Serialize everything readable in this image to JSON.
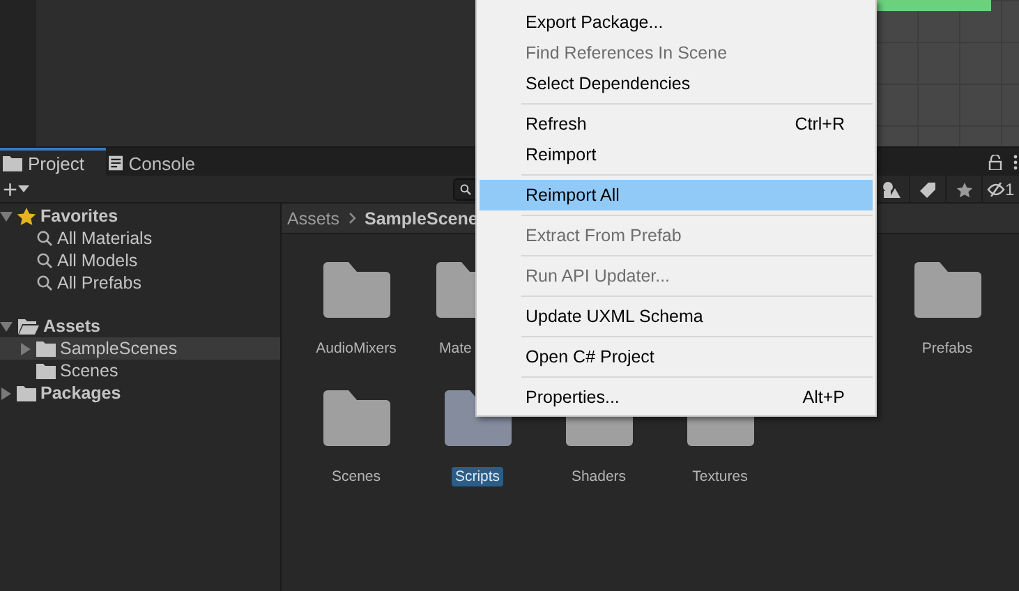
{
  "tabs": [
    {
      "label": "Project",
      "selected": true
    },
    {
      "label": "Console",
      "selected": false
    }
  ],
  "toolbar": {
    "add": "+",
    "filter_count": "1"
  },
  "tree": [
    {
      "label": "Favorites",
      "kind": "favorites",
      "expanded": true,
      "selected": false,
      "children": [
        {
          "label": "All Materials",
          "kind": "search",
          "selected": false
        },
        {
          "label": "All Models",
          "kind": "search",
          "selected": false
        },
        {
          "label": "All Prefabs",
          "kind": "search",
          "selected": false
        }
      ]
    },
    {
      "label": "Assets",
      "kind": "folder",
      "expanded": true,
      "selected": false,
      "children": [
        {
          "label": "SampleScenes",
          "kind": "folder",
          "expanded": false,
          "selected": true
        },
        {
          "label": "Scenes",
          "kind": "folder",
          "selected": false
        }
      ]
    },
    {
      "label": "Packages",
      "kind": "folder",
      "expanded": false,
      "selected": false
    }
  ],
  "breadcrumb": [
    "Assets",
    "SampleScene"
  ],
  "folder_rows": [
    {
      "items": [
        {
          "label": "AudioMixers",
          "selected": false,
          "clipped": false
        },
        {
          "label": "Mate",
          "selected": false,
          "clipped": true
        }
      ],
      "trailing": [
        {
          "label": "Prefabs",
          "selected": false,
          "clipped": false
        }
      ]
    },
    {
      "items": [
        {
          "label": "Scenes",
          "selected": false,
          "clipped": false
        },
        {
          "label": "Scripts",
          "selected": true,
          "clipped": false
        },
        {
          "label": "Shaders",
          "selected": false,
          "clipped": false
        },
        {
          "label": "Textures",
          "selected": false,
          "clipped": false
        }
      ],
      "trailing": []
    }
  ],
  "context_menu": [
    {
      "kind": "item",
      "label": "Export Package...",
      "disabled": false,
      "selected": false
    },
    {
      "kind": "item",
      "label": "Find References In Scene",
      "disabled": true,
      "selected": false
    },
    {
      "kind": "item",
      "label": "Select Dependencies",
      "disabled": false,
      "selected": false
    },
    {
      "kind": "separator"
    },
    {
      "kind": "item",
      "label": "Refresh",
      "shortcut": "Ctrl+R",
      "disabled": false,
      "selected": false
    },
    {
      "kind": "item",
      "label": "Reimport",
      "disabled": false,
      "selected": false
    },
    {
      "kind": "separator"
    },
    {
      "kind": "item",
      "label": "Reimport All",
      "disabled": false,
      "selected": true
    },
    {
      "kind": "separator"
    },
    {
      "kind": "item",
      "label": "Extract From Prefab",
      "disabled": true,
      "selected": false
    },
    {
      "kind": "separator"
    },
    {
      "kind": "item",
      "label": "Run API Updater...",
      "disabled": true,
      "selected": false
    },
    {
      "kind": "separator"
    },
    {
      "kind": "item",
      "label": "Update UXML Schema",
      "disabled": false,
      "selected": false
    },
    {
      "kind": "separator"
    },
    {
      "kind": "item",
      "label": "Open C# Project",
      "disabled": false,
      "selected": false
    },
    {
      "kind": "separator"
    },
    {
      "kind": "item",
      "label": "Properties...",
      "shortcut": "Alt+P",
      "disabled": false,
      "selected": false
    }
  ]
}
